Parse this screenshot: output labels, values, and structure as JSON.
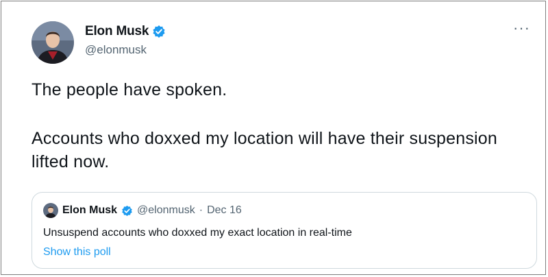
{
  "tweet": {
    "author": {
      "display_name": "Elon Musk",
      "handle": "@elonmusk",
      "verified": true
    },
    "more_label": "···",
    "text_lines": [
      "The people have spoken.",
      "Accounts who doxxed my location will have their suspension lifted now."
    ],
    "quote": {
      "display_name": "Elon Musk",
      "handle": "@elonmusk",
      "separator": "·",
      "date": "Dec 16",
      "text": "Unsuspend accounts who doxxed my exact location in real-time",
      "show_poll": "Show this poll"
    }
  },
  "colors": {
    "verified_blue": "#1d9bf0",
    "link_blue": "#1d9bf0",
    "secondary_text": "#536471",
    "border": "#cfd9de"
  },
  "icons": {
    "verified": "verified-badge-icon",
    "more": "more-options-icon"
  }
}
